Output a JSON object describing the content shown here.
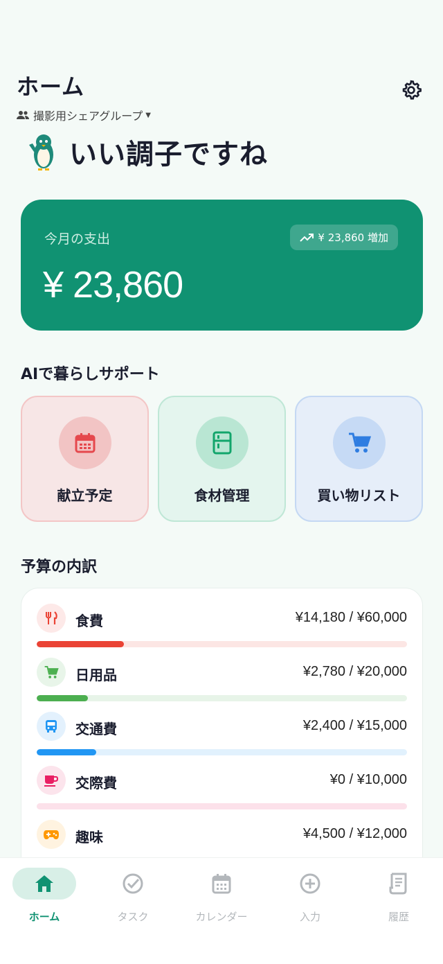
{
  "header": {
    "title": "ホーム",
    "group_name": "撮影用シェアグループ",
    "settings_icon": "gear-icon"
  },
  "mood": {
    "text": "いい調子ですね",
    "mascot_icon": "penguin-icon"
  },
  "spending": {
    "label": "今月の支出",
    "amount": "¥ 23,860",
    "badge": "¥ 23,860 増加",
    "badge_icon": "trending-up-icon",
    "card_color": "#109272"
  },
  "ai_section": {
    "title": "AIで暮らしサポート",
    "cards": [
      {
        "label": "献立予定",
        "icon": "calendar-icon",
        "color": "#e5484d"
      },
      {
        "label": "食材管理",
        "icon": "fridge-icon",
        "color": "#12a56b"
      },
      {
        "label": "買い物リスト",
        "icon": "cart-icon",
        "color": "#2f7de1"
      }
    ]
  },
  "budget_section": {
    "title": "予算の内訳",
    "items": [
      {
        "name": "食費",
        "amount": "¥14,180 / ¥60,000",
        "ratio": 0.236,
        "icon": "utensils-icon",
        "color": "#ea4335"
      },
      {
        "name": "日用品",
        "amount": "¥2,780 / ¥20,000",
        "ratio": 0.139,
        "icon": "cart-icon",
        "color": "#4caf50"
      },
      {
        "name": "交通費",
        "amount": "¥2,400 / ¥15,000",
        "ratio": 0.16,
        "icon": "bus-icon",
        "color": "#2196f3"
      },
      {
        "name": "交際費",
        "amount": "¥0 / ¥10,000",
        "ratio": 0.0,
        "icon": "cup-icon",
        "color": "#e91e63"
      },
      {
        "name": "趣味",
        "amount": "¥4,500 / ¥12,000",
        "ratio": 0.375,
        "icon": "gamepad-icon",
        "color": "#ff9800"
      }
    ]
  },
  "nav": {
    "items": [
      {
        "label": "ホーム",
        "icon": "home-icon",
        "active": true
      },
      {
        "label": "タスク",
        "icon": "check-circle-icon",
        "active": false
      },
      {
        "label": "カレンダー",
        "icon": "calendar-icon",
        "active": false
      },
      {
        "label": "入力",
        "icon": "plus-circle-icon",
        "active": false
      },
      {
        "label": "履歴",
        "icon": "receipt-icon",
        "active": false
      }
    ],
    "active_color": "#109272"
  }
}
